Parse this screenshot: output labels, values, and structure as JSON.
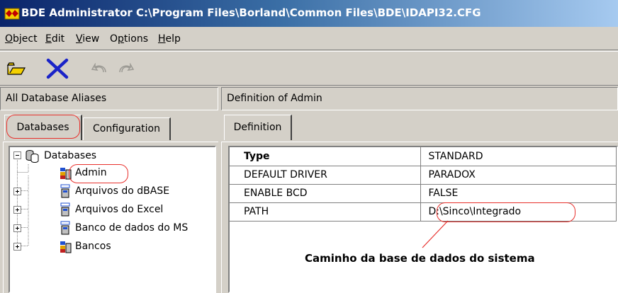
{
  "window": {
    "title": "BDE Administrator  C:\\Program Files\\Borland\\Common Files\\BDE\\IDAPI32.CFG"
  },
  "menu": [
    {
      "label": "Object",
      "underline": "O",
      "rest": "bject"
    },
    {
      "label": "Edit",
      "underline": "E",
      "rest": "dit"
    },
    {
      "label": "View",
      "underline": "V",
      "rest": "iew"
    },
    {
      "label": "Options",
      "underline": "O",
      "pre": "",
      "rest": "ptions"
    },
    {
      "label": "Help",
      "underline": "H",
      "rest": "elp"
    }
  ],
  "toolbar": {
    "icons": [
      "open-folder-icon",
      "delete-x-icon",
      "undo-icon",
      "redo-icon"
    ],
    "accent_delete": "#1a23c8"
  },
  "left": {
    "header": "All Database Aliases",
    "tabs": [
      "Databases",
      "Configuration"
    ],
    "tree": {
      "root": "Databases",
      "items": [
        {
          "label": "Admin",
          "expandable": false
        },
        {
          "label": "Arquivos do dBASE",
          "expandable": true
        },
        {
          "label": "Arquivos do Excel",
          "expandable": true
        },
        {
          "label": "Banco de dados do MS",
          "expandable": true
        },
        {
          "label": "Bancos",
          "expandable": true
        }
      ]
    }
  },
  "right": {
    "header": "Definition of Admin",
    "tabs": [
      "Definition"
    ],
    "properties": [
      {
        "key": "Type",
        "value": "STANDARD",
        "bold": true
      },
      {
        "key": "DEFAULT DRIVER",
        "value": "PARADOX"
      },
      {
        "key": "ENABLE BCD",
        "value": "FALSE"
      },
      {
        "key": "PATH",
        "value": "D:\\Sinco\\Integrado"
      }
    ]
  },
  "annotation": {
    "text": "Caminho da base de dados do sistema",
    "color": "#e8302c"
  }
}
